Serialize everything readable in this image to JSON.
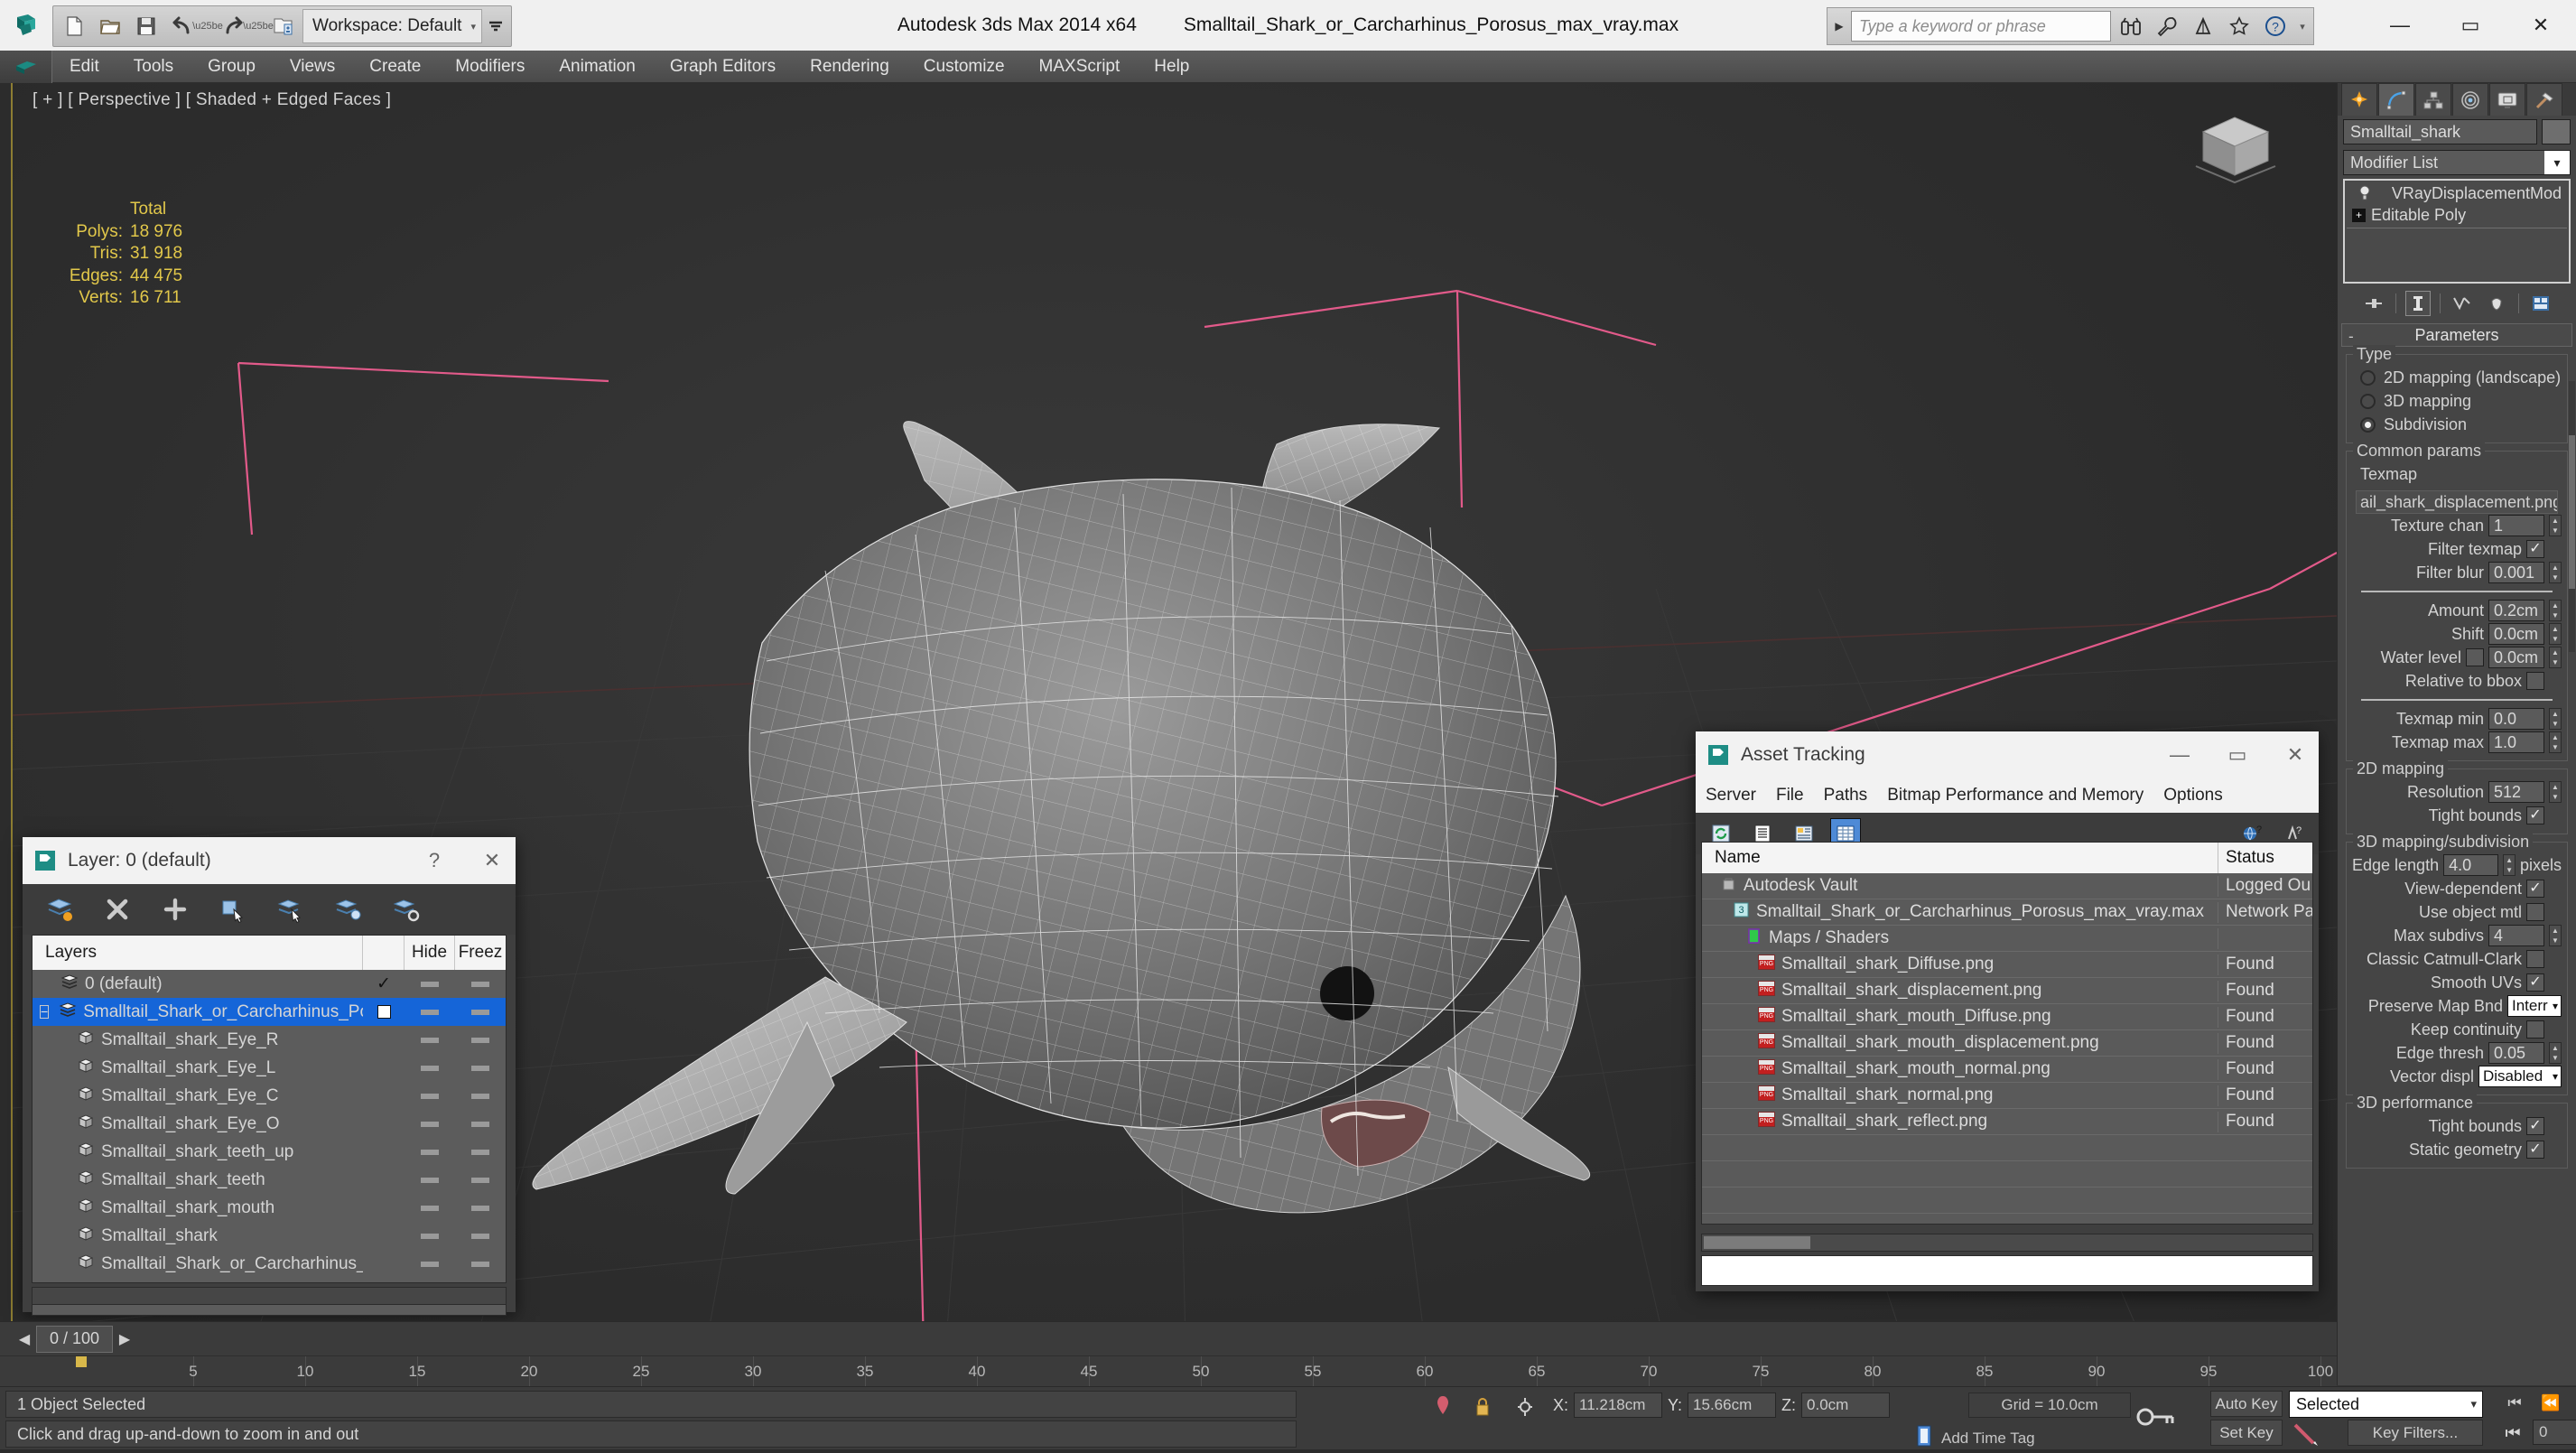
{
  "titlebar": {
    "workspace_label": "Workspace: Default",
    "app_title": "Autodesk 3ds Max  2014 x64",
    "file_title": "Smalltail_Shark_or_Carcharhinus_Porosus_max_vray.max",
    "search_placeholder": "Type a keyword or phrase",
    "quick_access": [
      "new-file-icon",
      "open-file-icon",
      "save-file-icon",
      "undo-icon",
      "redo-icon",
      "set-project-folder-icon"
    ],
    "search_icons": [
      "binoculars-icon",
      "wrench-icon",
      "satellite-icon",
      "star-icon",
      "help-circle-icon"
    ],
    "window_buttons": {
      "minimize": "—",
      "maximize": "▭",
      "close": "✕"
    }
  },
  "menubar": {
    "items": [
      "Edit",
      "Tools",
      "Group",
      "Views",
      "Create",
      "Modifiers",
      "Animation",
      "Graph Editors",
      "Rendering",
      "Customize",
      "MAXScript",
      "Help"
    ]
  },
  "viewport": {
    "label": "[ + ] [ Perspective ] [ Shaded + Edged Faces ]",
    "stats_header": "Total",
    "stats": [
      {
        "label": "Polys:",
        "value": "18 976"
      },
      {
        "label": "Tris:",
        "value": "31 918"
      },
      {
        "label": "Edges:",
        "value": "44 475"
      },
      {
        "label": "Verts:",
        "value": "16 711"
      }
    ]
  },
  "layer_dialog": {
    "title": "Layer: 0 (default)",
    "help_btn": "?",
    "close_btn": "✕",
    "toolbar_icons": [
      "new-layer-icon",
      "delete-layer-icon",
      "add-layer-icon",
      "select-objects-icon",
      "select-highlighted-icon",
      "add-selection-icon",
      "layer-properties-icon"
    ],
    "columns": [
      "Layers",
      "",
      "Hide",
      "Freez"
    ],
    "rows": [
      {
        "name": "0 (default)",
        "indent": 1,
        "icon": "layer-icon",
        "current": "✓",
        "selected": false,
        "expander": ""
      },
      {
        "name": "Smalltail_Shark_or_Carcharhinus_Porosus",
        "indent": 0,
        "icon": "layer-icon",
        "current": "box",
        "selected": true,
        "expander": "−"
      },
      {
        "name": "Smalltail_shark_Eye_R",
        "indent": 2,
        "icon": "object-cube-icon",
        "current": "",
        "selected": false,
        "expander": ""
      },
      {
        "name": "Smalltail_shark_Eye_L",
        "indent": 2,
        "icon": "object-cube-icon",
        "current": "",
        "selected": false,
        "expander": ""
      },
      {
        "name": "Smalltail_shark_Eye_C",
        "indent": 2,
        "icon": "object-cube-icon",
        "current": "",
        "selected": false,
        "expander": ""
      },
      {
        "name": "Smalltail_shark_Eye_O",
        "indent": 2,
        "icon": "object-cube-icon",
        "current": "",
        "selected": false,
        "expander": ""
      },
      {
        "name": "Smalltail_shark_teeth_up",
        "indent": 2,
        "icon": "object-cube-icon",
        "current": "",
        "selected": false,
        "expander": ""
      },
      {
        "name": "Smalltail_shark_teeth",
        "indent": 2,
        "icon": "object-cube-icon",
        "current": "",
        "selected": false,
        "expander": ""
      },
      {
        "name": "Smalltail_shark_mouth",
        "indent": 2,
        "icon": "object-cube-icon",
        "current": "",
        "selected": false,
        "expander": ""
      },
      {
        "name": "Smalltail_shark",
        "indent": 2,
        "icon": "object-cube-icon",
        "current": "",
        "selected": false,
        "expander": ""
      },
      {
        "name": "Smalltail_Shark_or_Carcharhinus_Porosus",
        "indent": 2,
        "icon": "object-cube-icon",
        "current": "",
        "selected": false,
        "expander": ""
      }
    ]
  },
  "asset_dialog": {
    "title": "Asset Tracking",
    "menu": [
      "Server",
      "File",
      "Paths",
      "Bitmap Performance and Memory",
      "Options"
    ],
    "toolbar_icons": [
      "refresh-icon",
      "list-view-icon",
      "detail-view-icon",
      "grid-view-icon"
    ],
    "toolbar_right_icons": [
      "help-globe-icon",
      "help-question-icon"
    ],
    "columns": [
      "Name",
      "Status"
    ],
    "rows": [
      {
        "name": "Autodesk Vault",
        "status": "Logged Ou",
        "indent": 1,
        "icon": "vault-icon"
      },
      {
        "name": "Smalltail_Shark_or_Carcharhinus_Porosus_max_vray.max",
        "status": "Network Pa",
        "indent": 2,
        "icon": "max-file-icon"
      },
      {
        "name": "Maps / Shaders",
        "status": "",
        "indent": 3,
        "icon": "maps-shaders-icon"
      },
      {
        "name": "Smalltail_shark_Diffuse.png",
        "status": "Found",
        "indent": 4,
        "icon": "png-icon"
      },
      {
        "name": "Smalltail_shark_displacement.png",
        "status": "Found",
        "indent": 4,
        "icon": "png-icon"
      },
      {
        "name": "Smalltail_shark_mouth_Diffuse.png",
        "status": "Found",
        "indent": 4,
        "icon": "png-icon"
      },
      {
        "name": "Smalltail_shark_mouth_displacement.png",
        "status": "Found",
        "indent": 4,
        "icon": "png-icon"
      },
      {
        "name": "Smalltail_shark_mouth_normal.png",
        "status": "Found",
        "indent": 4,
        "icon": "png-icon"
      },
      {
        "name": "Smalltail_shark_normal.png",
        "status": "Found",
        "indent": 4,
        "icon": "png-icon"
      },
      {
        "name": "Smalltail_shark_reflect.png",
        "status": "Found",
        "indent": 4,
        "icon": "png-icon"
      }
    ],
    "empty_row_count": 5
  },
  "command_panel": {
    "tabs": [
      "create-tab",
      "modify-tab",
      "hierarchy-tab",
      "motion-tab",
      "display-tab",
      "utilities-tab"
    ],
    "active_tab_index": 1,
    "object_name": "Smalltail_shark",
    "modifier_list_label": "Modifier List",
    "modifier_stack": [
      {
        "label": "VRayDisplacementMod",
        "icon": "light-bulb-icon",
        "selected": true
      },
      {
        "label": "Editable Poly",
        "icon": "plus-box-icon",
        "selected": false
      }
    ],
    "stack_tools": [
      "pin-stack-icon",
      "show-end-result-icon",
      "make-unique-icon",
      "remove-modifier-icon",
      "configure-sets-icon"
    ],
    "rollout_title": "Parameters",
    "rollout_minus": "-",
    "type_group": {
      "title": "Type",
      "options": [
        {
          "label": "2D mapping (landscape)",
          "selected": false
        },
        {
          "label": "3D mapping",
          "selected": false
        },
        {
          "label": "Subdivision",
          "selected": true
        }
      ]
    },
    "common_params": {
      "title": "Common params",
      "texmap_label": "Texmap",
      "texmap_value": "ail_shark_displacement.png)",
      "texture_chan_label": "Texture chan",
      "texture_chan_value": "1",
      "filter_texmap_label": "Filter texmap",
      "filter_texmap_checked": true,
      "filter_blur_label": "Filter blur",
      "filter_blur_value": "0.001",
      "amount_label": "Amount",
      "amount_value": "0.2cm",
      "shift_label": "Shift",
      "shift_value": "0.0cm",
      "water_level_label": "Water level",
      "water_level_checked": false,
      "water_level_value": "0.0cm",
      "relative_bbox_label": "Relative to bbox",
      "relative_bbox_checked": false,
      "texmap_min_label": "Texmap min",
      "texmap_min_value": "0.0",
      "texmap_max_label": "Texmap max",
      "texmap_max_value": "1.0"
    },
    "mapping2d": {
      "title": "2D mapping",
      "resolution_label": "Resolution",
      "resolution_value": "512",
      "tight_bounds_label": "Tight bounds",
      "tight_bounds_checked": true
    },
    "mapping3d": {
      "title": "3D mapping/subdivision",
      "edge_length_label": "Edge length",
      "edge_length_value": "4.0",
      "edge_length_unit": "pixels",
      "view_dependent_label": "View-dependent",
      "view_dependent_checked": true,
      "use_object_mtl_label": "Use object mtl",
      "use_object_mtl_checked": false,
      "max_subdivs_label": "Max subdivs",
      "max_subdivs_value": "4",
      "catmull_label": "Classic Catmull-Clark",
      "catmull_checked": false,
      "smooth_uvs_label": "Smooth UVs",
      "smooth_uvs_checked": true,
      "preserve_map_label": "Preserve Map Bnd",
      "preserve_map_value": "Interr",
      "keep_continuity_label": "Keep continuity",
      "keep_continuity_checked": false,
      "edge_thresh_label": "Edge thresh",
      "edge_thresh_value": "0.05",
      "vector_displ_label": "Vector displ",
      "vector_displ_value": "Disabled"
    },
    "performance3d": {
      "title": "3D performance",
      "tight_bounds_label": "Tight bounds",
      "tight_bounds_checked": true,
      "static_geometry_label": "Static geometry",
      "static_geometry_checked": true
    }
  },
  "timeline": {
    "slider_label": "0 / 100",
    "prev_arrow": "◀",
    "next_arrow": "▶",
    "ruler_ticks": [
      "5",
      "10",
      "15",
      "20",
      "25",
      "30",
      "35",
      "40",
      "45",
      "50",
      "55",
      "60",
      "65",
      "70",
      "75",
      "80",
      "85",
      "90",
      "95",
      "100"
    ]
  },
  "statusbar": {
    "selection_status": "1 Object Selected",
    "prompt": "Click and drag up-and-down to zoom in and out",
    "coord_x_label": "X:",
    "coord_x_value": "11.218cm",
    "coord_y_label": "Y:",
    "coord_y_value": "15.66cm",
    "coord_z_label": "Z:",
    "coord_z_value": "0.0cm",
    "grid_label": "Grid = 10.0cm",
    "add_time_tag": "Add Time Tag",
    "auto_key": "Auto Key",
    "set_key": "Set Key",
    "selection_filter": "Selected",
    "key_filters": "Key Filters...",
    "frame_value": "0",
    "icons": [
      "pin-icon",
      "lock-icon",
      "absolute-mode-icon",
      "key-mode-icon",
      "time-tag-icon",
      "set-key-pen-icon"
    ]
  },
  "colors": {
    "accent_blue": "#1565d8",
    "stats_yellow": "#e2c84a",
    "viewport_bg": "#2e2e2e",
    "panel_bg": "#454545",
    "dialog_titlebar": "#f2f2f2",
    "gizmo_pink": "#e25a8a"
  }
}
